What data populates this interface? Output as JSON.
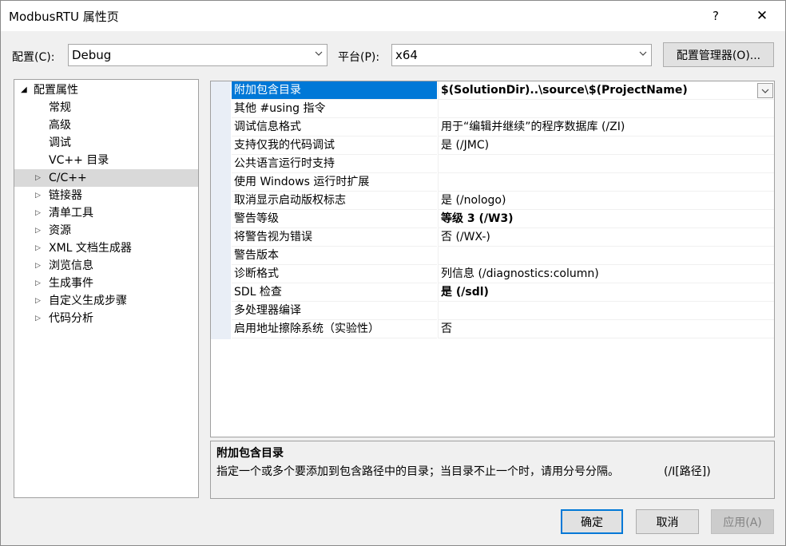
{
  "window": {
    "title": "ModbusRTU 属性页",
    "help_label": "?",
    "close_label": "✕"
  },
  "toolbar": {
    "config_label": "配置(C):",
    "config_value": "Debug",
    "platform_label": "平台(P):",
    "platform_value": "x64",
    "config_manager_label": "配置管理器(O)..."
  },
  "tree": {
    "root_label": "配置属性",
    "items": [
      {
        "label": "常规",
        "expandable": false
      },
      {
        "label": "高级",
        "expandable": false
      },
      {
        "label": "调试",
        "expandable": false
      },
      {
        "label": "VC++ 目录",
        "expandable": false
      },
      {
        "label": "C/C++",
        "expandable": true,
        "selected": true
      },
      {
        "label": "链接器",
        "expandable": true
      },
      {
        "label": "清单工具",
        "expandable": true
      },
      {
        "label": "资源",
        "expandable": true
      },
      {
        "label": "XML 文档生成器",
        "expandable": true
      },
      {
        "label": "浏览信息",
        "expandable": true
      },
      {
        "label": "生成事件",
        "expandable": true
      },
      {
        "label": "自定义生成步骤",
        "expandable": true
      },
      {
        "label": "代码分析",
        "expandable": true
      }
    ]
  },
  "properties": [
    {
      "name": "附加包含目录",
      "value": "$(SolutionDir)..\\source\\$(ProjectName)",
      "bold": true,
      "selected": true
    },
    {
      "name": "其他 #using 指令",
      "value": ""
    },
    {
      "name": "调试信息格式",
      "value": "用于“编辑并继续”的程序数据库 (/ZI)"
    },
    {
      "name": "支持仅我的代码调试",
      "value": "是 (/JMC)"
    },
    {
      "name": "公共语言运行时支持",
      "value": ""
    },
    {
      "name": "使用 Windows 运行时扩展",
      "value": ""
    },
    {
      "name": "取消显示启动版权标志",
      "value": "是 (/nologo)"
    },
    {
      "name": "警告等级",
      "value": "等级 3 (/W3)",
      "bold": true
    },
    {
      "name": "将警告视为错误",
      "value": "否 (/WX-)"
    },
    {
      "name": "警告版本",
      "value": ""
    },
    {
      "name": "诊断格式",
      "value": "列信息 (/diagnostics:column)"
    },
    {
      "name": "SDL 检查",
      "value": "是 (/sdl)",
      "bold": true
    },
    {
      "name": "多处理器编译",
      "value": ""
    },
    {
      "name": "启用地址擦除系统（实验性）",
      "value": "否"
    }
  ],
  "description": {
    "title": "附加包含目录",
    "text": "指定一个或多个要添加到包含路径中的目录；当目录不止一个时，请用分号分隔。",
    "hint": "(/I[路径])"
  },
  "buttons": {
    "ok": "确定",
    "cancel": "取消",
    "apply": "应用(A)"
  },
  "colors": {
    "selection": "#0078d7",
    "tree_selection": "#d9d9d9"
  }
}
